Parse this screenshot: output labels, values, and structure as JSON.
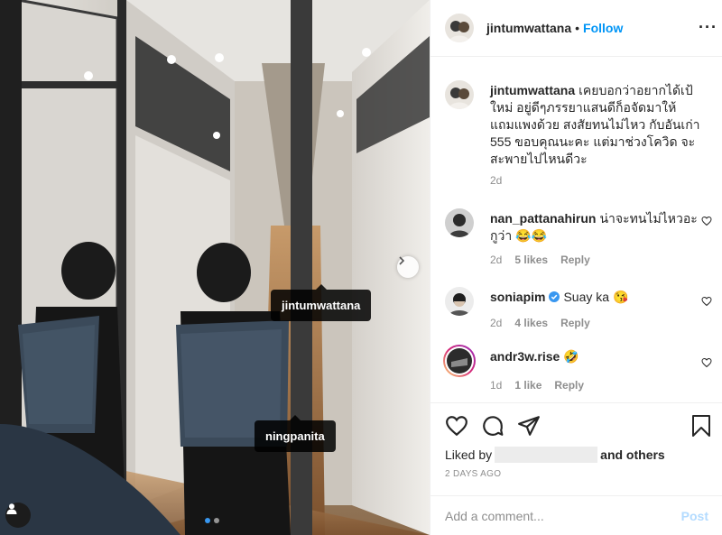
{
  "photo": {
    "tags": [
      "jintumwattana",
      "ningpanita"
    ],
    "carousel_count": 2,
    "carousel_active": 1
  },
  "header": {
    "username": "jintumwattana",
    "separator": "•",
    "follow_label": "Follow",
    "more_label": "···"
  },
  "caption": {
    "username": "jintumwattana",
    "text": "เคยบอกว่าอยากได้เป้ใหม่ อยู่ดีๆภรรยาแสนดีก็อจัดมาให้ แถมแพงด้วย สงสัยทนไม่ไหว กับอันเก่า 555 ขอบคุณนะคะ แต่มาช่วงโควิด จะสะพายไปไหนดีวะ",
    "time": "2d"
  },
  "comments": [
    {
      "username": "nan_pattanahirun",
      "verified": false,
      "text": "น่าจะทนไม่ไหวอะกูว่า 😂😂",
      "time": "2d",
      "likes": "5 likes",
      "reply": "Reply"
    },
    {
      "username": "soniapim",
      "verified": true,
      "text": "Suay ka 😘",
      "time": "2d",
      "likes": "4 likes",
      "reply": "Reply"
    },
    {
      "username": "andr3w.rise",
      "verified": false,
      "text": "🤣",
      "time": "1d",
      "likes": "1 like",
      "reply": "Reply"
    }
  ],
  "actions": {
    "liked_by_label": "Liked by",
    "liked_by_and": "and others",
    "date": "2 DAYS AGO",
    "icons": [
      "heart-icon",
      "comment-icon",
      "share-icon",
      "bookmark-icon"
    ]
  },
  "add_comment": {
    "placeholder": "Add a comment...",
    "post_label": "Post"
  },
  "colors": {
    "accent": "#0095f6",
    "verified": "#3897f0",
    "post_disabled": "#b3dbff",
    "muted": "#8e8e8e"
  }
}
